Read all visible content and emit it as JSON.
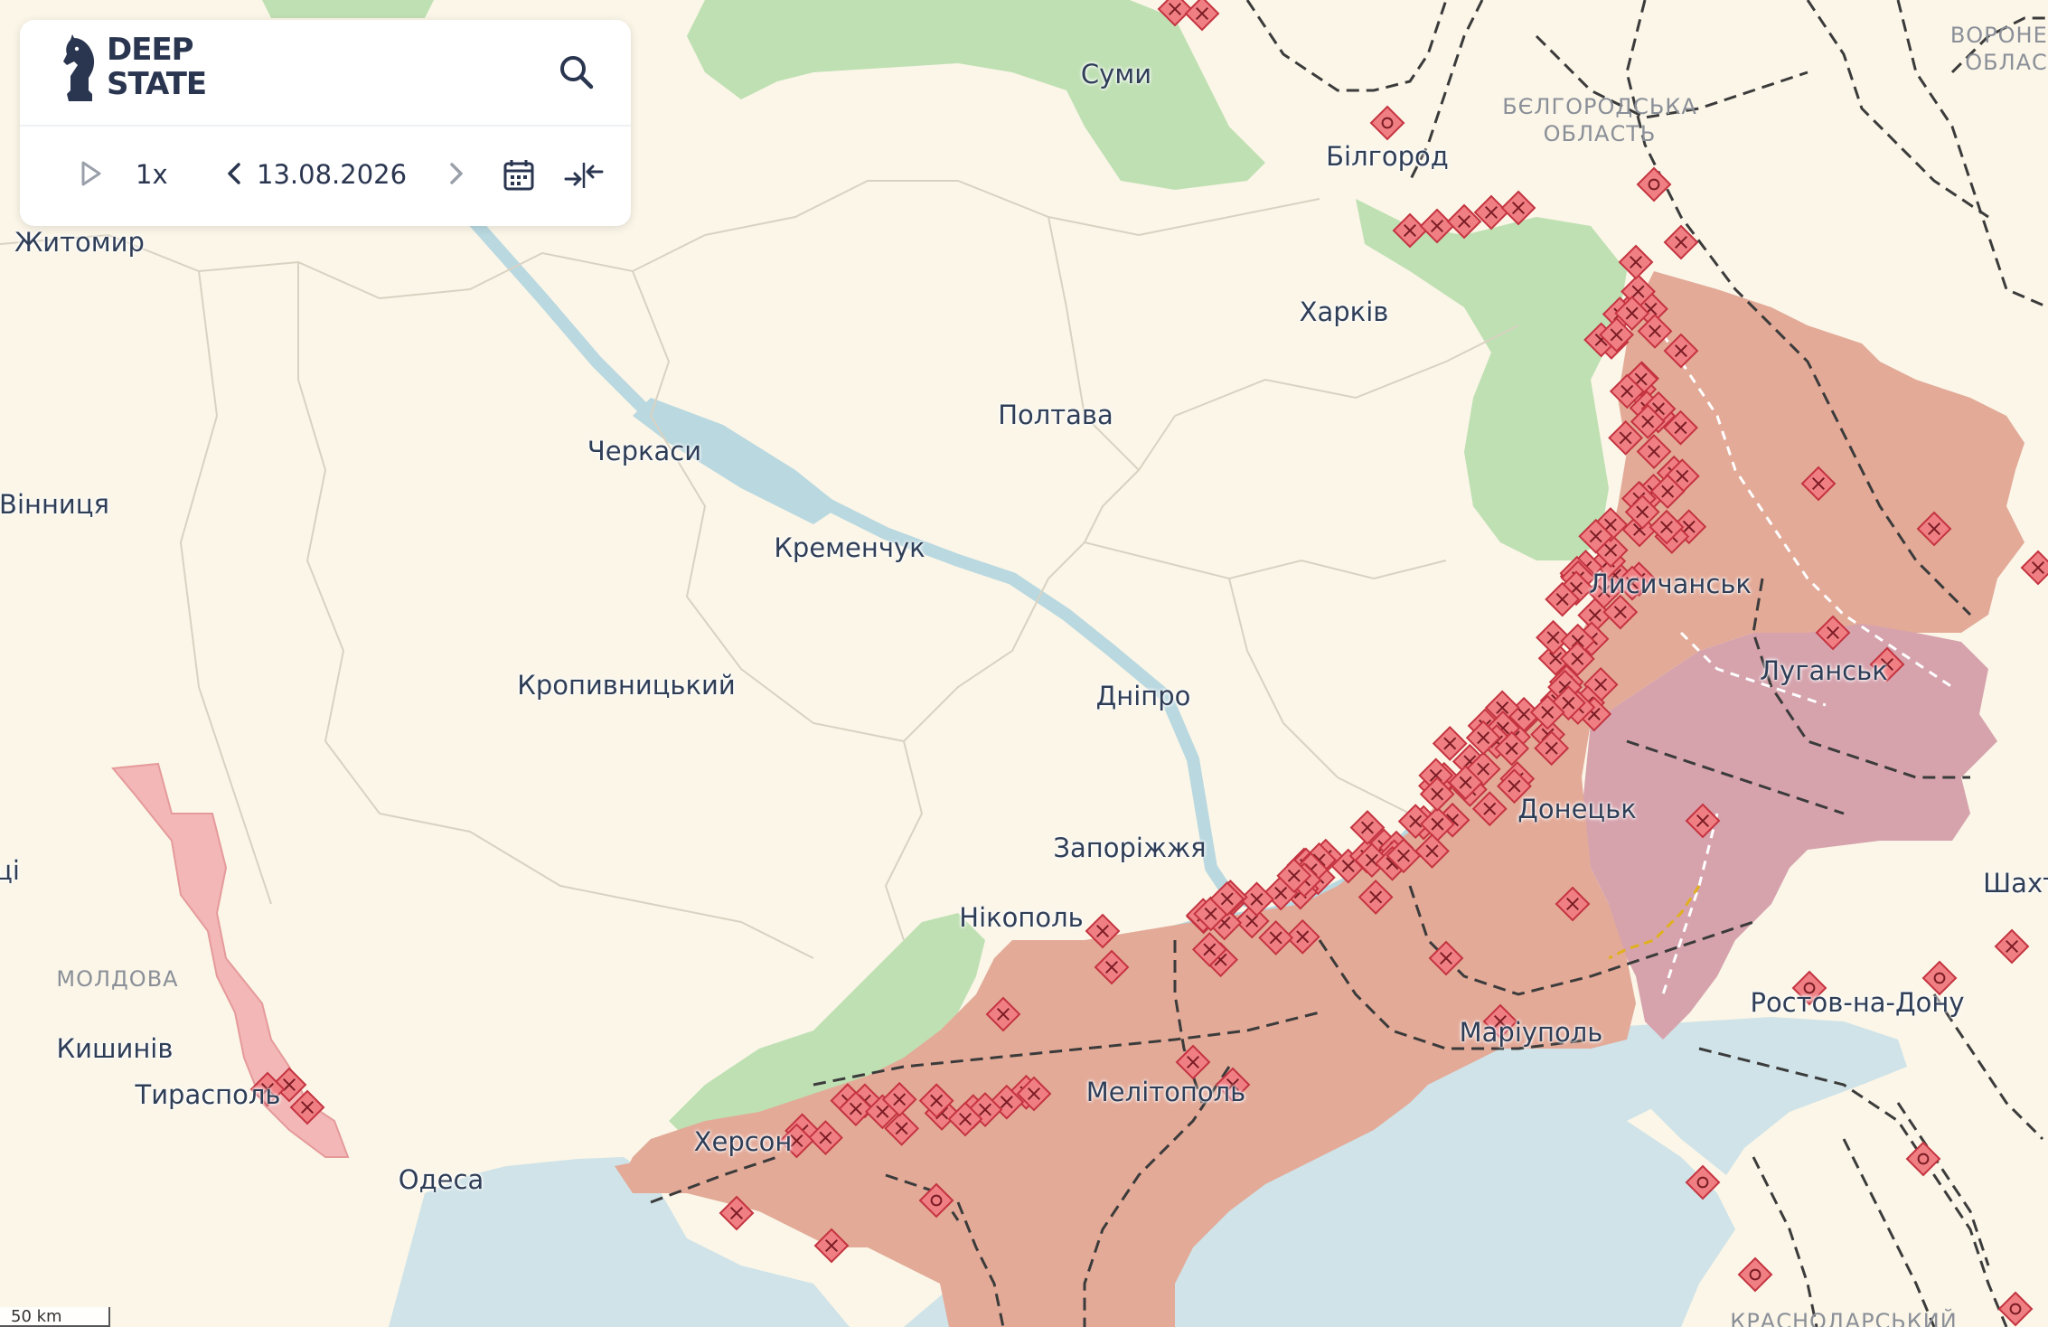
{
  "brand": {
    "line1": "DEEP",
    "line2": "STATE",
    "logo_icon": "knight-chess-piece-icon"
  },
  "controls": {
    "play_icon": "play-icon",
    "speed": "1x",
    "prev_icon": "chevron-left-icon",
    "date": "13.08.2026",
    "next_icon": "chevron-right-icon",
    "calendar_icon": "calendar-icon",
    "compare_icon": "compare-arrows-icon",
    "search_icon": "search-icon"
  },
  "scale": {
    "label": "50 km"
  },
  "cities": [
    {
      "key": "sumy",
      "name": "Суми"
    },
    {
      "key": "bilgorod",
      "name": "Білгород"
    },
    {
      "key": "kharkiv",
      "name": "Харків"
    },
    {
      "key": "zhytomyr",
      "name": "Житомир"
    },
    {
      "key": "poltava",
      "name": "Полтава"
    },
    {
      "key": "cherkasy",
      "name": "Черкаси"
    },
    {
      "key": "vinnytsia",
      "name": "Вінниця"
    },
    {
      "key": "kremenchuk",
      "name": "Кременчук"
    },
    {
      "key": "lysychansk",
      "name": "Лисичанськ"
    },
    {
      "key": "luhansk",
      "name": "Луганськ"
    },
    {
      "key": "kropyvnytskyi",
      "name": "Кропивницький"
    },
    {
      "key": "dnipro",
      "name": "Дніпро"
    },
    {
      "key": "donetsk",
      "name": "Донецьк"
    },
    {
      "key": "zaporizhzhia",
      "name": "Запоріжжя"
    },
    {
      "key": "shakhty",
      "name": "Шахти"
    },
    {
      "key": "nikopol",
      "name": "Нікополь"
    },
    {
      "key": "rostov",
      "name": "Ростов-на-Дону"
    },
    {
      "key": "mariupol",
      "name": "Маріуполь"
    },
    {
      "key": "kyshyniv",
      "name": "Кишинів"
    },
    {
      "key": "tyraspol",
      "name": "Тирасполь"
    },
    {
      "key": "melitopol",
      "name": "Мелітополь"
    },
    {
      "key": "kherson",
      "name": "Херсон"
    },
    {
      "key": "odesa",
      "name": "Одеса"
    },
    {
      "key": "partial-west",
      "name": "ці"
    }
  ],
  "regions": [
    {
      "key": "belgorod-oblast",
      "line1": "БЄЛГОРОДСЬКА",
      "line2": "ОБЛАСТЬ"
    },
    {
      "key": "voronezh-oblast",
      "line1": "ВОРОНЕЗ",
      "line2": "ОБЛАС"
    },
    {
      "key": "moldova",
      "line1": "МОЛДОВА",
      "line2": ""
    },
    {
      "key": "krasnodar",
      "line1": "КРАСНОДАРСЬКИЙ",
      "line2": ""
    }
  ],
  "colors": {
    "land": "#fbf6e8",
    "sea": "#cfe3e8",
    "occupied": "#e3aa98",
    "occupied_pre2022": "#d6a3ad",
    "liberated": "#bfe0b3",
    "transnistria": "#f3b7b7",
    "marker": "#f07f84",
    "marker_stroke": "#c43440"
  }
}
